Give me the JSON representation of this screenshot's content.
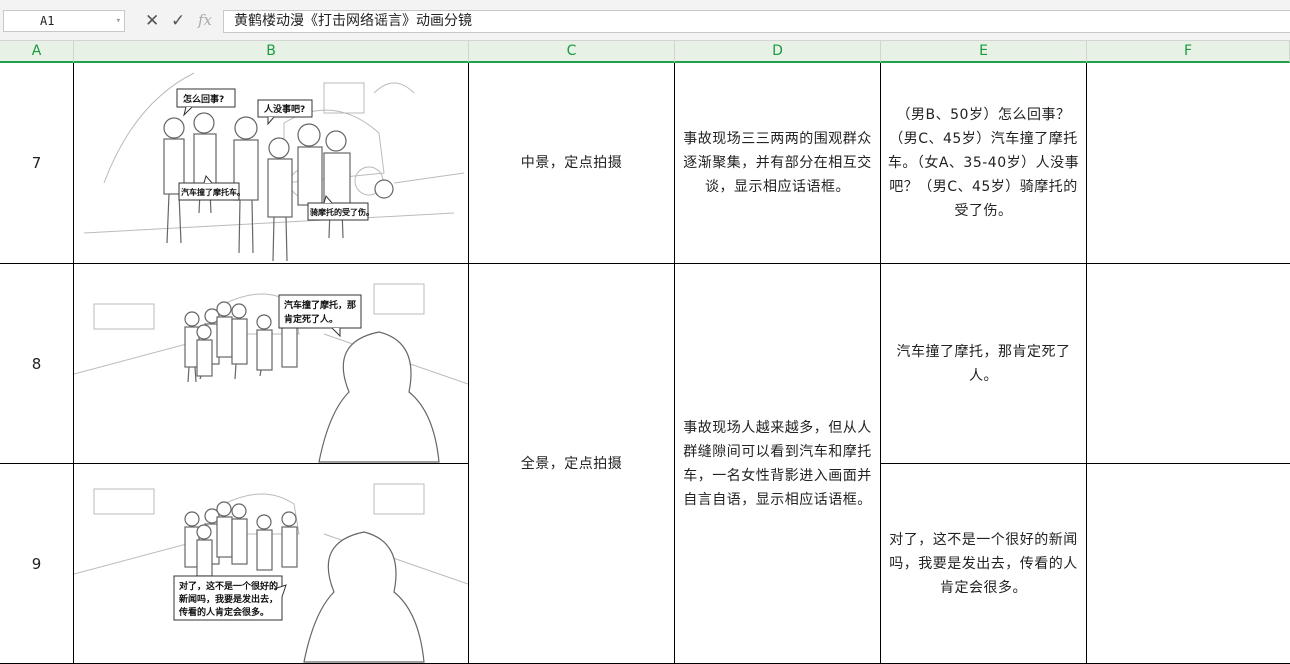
{
  "formula_bar": {
    "cell_ref": "A1",
    "cancel_icon": "✕",
    "confirm_icon": "✓",
    "fx_label": "fx",
    "content": "黄鹤楼动漫《打击网络谣言》动画分镜"
  },
  "columns": [
    "A",
    "B",
    "C",
    "D",
    "E",
    "F"
  ],
  "rows": [
    {
      "no": "7",
      "shot": "中景，定点拍摄",
      "desc": "事故现场三三两两的围观群众逐渐聚集，并有部分在相互交谈，显示相应话语框。",
      "dialogue": "（男B、50岁）怎么回事？（男C、45岁）汽车撞了摩托车。（女A、35-40岁）人没事吧？（男C、45岁）骑摩托的受了伤。",
      "bubbles": [
        "怎么回事?",
        "人没事吧?",
        "汽车撞了摩托车。",
        "骑摩托的受了伤。"
      ]
    },
    {
      "no": "8",
      "dialogue": "汽车撞了摩托，那肯定死了人。",
      "bubbles": [
        "汽车撞了摩托，那",
        "肯定死了人。"
      ]
    },
    {
      "no": "9",
      "dialogue": "对了，这不是一个很好的新闻吗，我要是发出去，传看的人肯定会很多。",
      "bubbles": [
        "对了，这不是一个很好的",
        "新闻吗，我要是发出去，",
        "传看的人肯定会很多。"
      ]
    }
  ],
  "merged_89": {
    "shot": "全景，定点拍摄",
    "desc": "事故现场人越来越多，但从人群缝隙间可以看到汽车和摩托车，一名女性背影进入画面并自言自语，显示相应话语框。"
  }
}
